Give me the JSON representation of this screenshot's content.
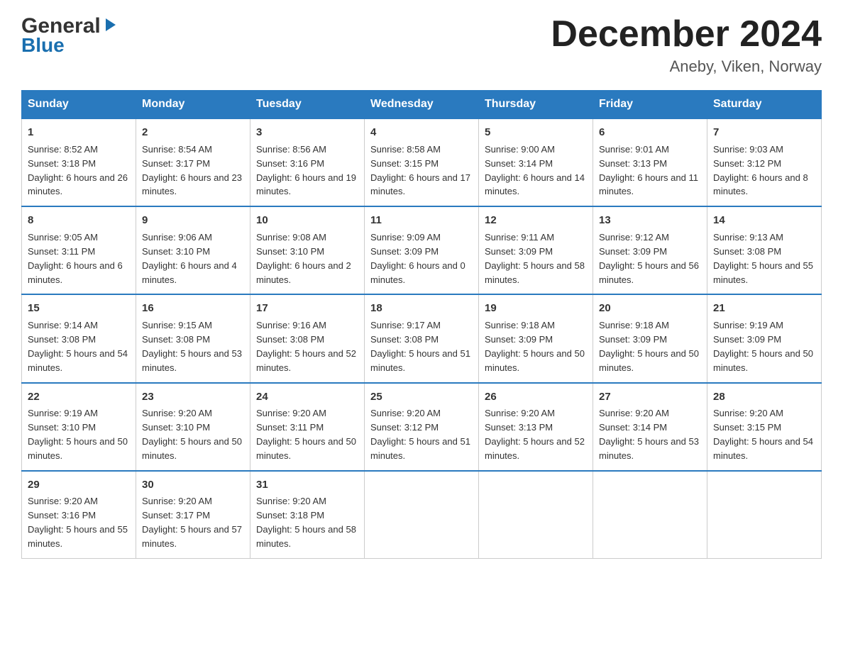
{
  "logo": {
    "general": "General",
    "blue": "Blue"
  },
  "header": {
    "title": "December 2024",
    "subtitle": "Aneby, Viken, Norway"
  },
  "days_of_week": [
    "Sunday",
    "Monday",
    "Tuesday",
    "Wednesday",
    "Thursday",
    "Friday",
    "Saturday"
  ],
  "weeks": [
    [
      {
        "day": "1",
        "sunrise": "8:52 AM",
        "sunset": "3:18 PM",
        "daylight": "6 hours and 26 minutes."
      },
      {
        "day": "2",
        "sunrise": "8:54 AM",
        "sunset": "3:17 PM",
        "daylight": "6 hours and 23 minutes."
      },
      {
        "day": "3",
        "sunrise": "8:56 AM",
        "sunset": "3:16 PM",
        "daylight": "6 hours and 19 minutes."
      },
      {
        "day": "4",
        "sunrise": "8:58 AM",
        "sunset": "3:15 PM",
        "daylight": "6 hours and 17 minutes."
      },
      {
        "day": "5",
        "sunrise": "9:00 AM",
        "sunset": "3:14 PM",
        "daylight": "6 hours and 14 minutes."
      },
      {
        "day": "6",
        "sunrise": "9:01 AM",
        "sunset": "3:13 PM",
        "daylight": "6 hours and 11 minutes."
      },
      {
        "day": "7",
        "sunrise": "9:03 AM",
        "sunset": "3:12 PM",
        "daylight": "6 hours and 8 minutes."
      }
    ],
    [
      {
        "day": "8",
        "sunrise": "9:05 AM",
        "sunset": "3:11 PM",
        "daylight": "6 hours and 6 minutes."
      },
      {
        "day": "9",
        "sunrise": "9:06 AM",
        "sunset": "3:10 PM",
        "daylight": "6 hours and 4 minutes."
      },
      {
        "day": "10",
        "sunrise": "9:08 AM",
        "sunset": "3:10 PM",
        "daylight": "6 hours and 2 minutes."
      },
      {
        "day": "11",
        "sunrise": "9:09 AM",
        "sunset": "3:09 PM",
        "daylight": "6 hours and 0 minutes."
      },
      {
        "day": "12",
        "sunrise": "9:11 AM",
        "sunset": "3:09 PM",
        "daylight": "5 hours and 58 minutes."
      },
      {
        "day": "13",
        "sunrise": "9:12 AM",
        "sunset": "3:09 PM",
        "daylight": "5 hours and 56 minutes."
      },
      {
        "day": "14",
        "sunrise": "9:13 AM",
        "sunset": "3:08 PM",
        "daylight": "5 hours and 55 minutes."
      }
    ],
    [
      {
        "day": "15",
        "sunrise": "9:14 AM",
        "sunset": "3:08 PM",
        "daylight": "5 hours and 54 minutes."
      },
      {
        "day": "16",
        "sunrise": "9:15 AM",
        "sunset": "3:08 PM",
        "daylight": "5 hours and 53 minutes."
      },
      {
        "day": "17",
        "sunrise": "9:16 AM",
        "sunset": "3:08 PM",
        "daylight": "5 hours and 52 minutes."
      },
      {
        "day": "18",
        "sunrise": "9:17 AM",
        "sunset": "3:08 PM",
        "daylight": "5 hours and 51 minutes."
      },
      {
        "day": "19",
        "sunrise": "9:18 AM",
        "sunset": "3:09 PM",
        "daylight": "5 hours and 50 minutes."
      },
      {
        "day": "20",
        "sunrise": "9:18 AM",
        "sunset": "3:09 PM",
        "daylight": "5 hours and 50 minutes."
      },
      {
        "day": "21",
        "sunrise": "9:19 AM",
        "sunset": "3:09 PM",
        "daylight": "5 hours and 50 minutes."
      }
    ],
    [
      {
        "day": "22",
        "sunrise": "9:19 AM",
        "sunset": "3:10 PM",
        "daylight": "5 hours and 50 minutes."
      },
      {
        "day": "23",
        "sunrise": "9:20 AM",
        "sunset": "3:10 PM",
        "daylight": "5 hours and 50 minutes."
      },
      {
        "day": "24",
        "sunrise": "9:20 AM",
        "sunset": "3:11 PM",
        "daylight": "5 hours and 50 minutes."
      },
      {
        "day": "25",
        "sunrise": "9:20 AM",
        "sunset": "3:12 PM",
        "daylight": "5 hours and 51 minutes."
      },
      {
        "day": "26",
        "sunrise": "9:20 AM",
        "sunset": "3:13 PM",
        "daylight": "5 hours and 52 minutes."
      },
      {
        "day": "27",
        "sunrise": "9:20 AM",
        "sunset": "3:14 PM",
        "daylight": "5 hours and 53 minutes."
      },
      {
        "day": "28",
        "sunrise": "9:20 AM",
        "sunset": "3:15 PM",
        "daylight": "5 hours and 54 minutes."
      }
    ],
    [
      {
        "day": "29",
        "sunrise": "9:20 AM",
        "sunset": "3:16 PM",
        "daylight": "5 hours and 55 minutes."
      },
      {
        "day": "30",
        "sunrise": "9:20 AM",
        "sunset": "3:17 PM",
        "daylight": "5 hours and 57 minutes."
      },
      {
        "day": "31",
        "sunrise": "9:20 AM",
        "sunset": "3:18 PM",
        "daylight": "5 hours and 58 minutes."
      },
      null,
      null,
      null,
      null
    ]
  ]
}
